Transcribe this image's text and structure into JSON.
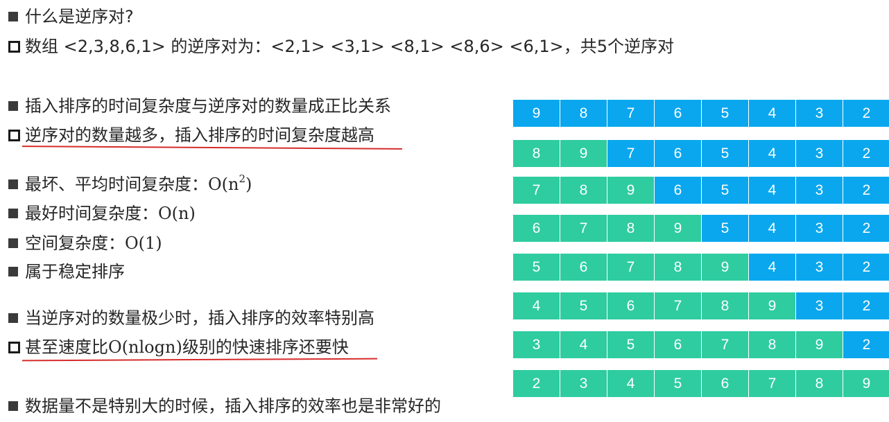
{
  "lines": [
    {
      "bullet": "filled",
      "text": "什么是逆序对?"
    },
    {
      "bullet": "hollow",
      "text": "数组 <2,3,8,6,1> 的逆序对为：<2,1> <3,1> <8,1> <8,6> <6,1>，共5个逆序对"
    },
    {
      "bullet": "filled",
      "text": "插入排序的时间复杂度与逆序对的数量成正比关系"
    },
    {
      "bullet": "hollow",
      "text": "逆序对的数量越多，插入排序的时间复杂度越高"
    },
    {
      "bullet": "filled",
      "prefix": "最坏、平均时间复杂度：",
      "math": "O(n",
      "sup": "2",
      "math_close": ")"
    },
    {
      "bullet": "filled",
      "prefix": "最好时间复杂度：",
      "math": "O(n)"
    },
    {
      "bullet": "filled",
      "prefix": "空间复杂度：",
      "math": "O(1)"
    },
    {
      "bullet": "filled",
      "text": "属于稳定排序"
    },
    {
      "bullet": "filled",
      "text": "当逆序对的数量极少时，插入排序的效率特别高"
    },
    {
      "bullet": "hollow",
      "prefix": "甚至速度比 ",
      "math": "O(nlogn)",
      "suffix": " 级别的快速排序还要快"
    },
    {
      "bullet": "filled",
      "text": "数据量不是特别大的时候，插入排序的效率也是非常好的"
    }
  ],
  "colors": {
    "unsorted": "#0aa7ee",
    "sorted": "#2fcca0",
    "underline": "#d62b2b"
  },
  "array_rows": [
    {
      "values": [
        9,
        8,
        7,
        6,
        5,
        4,
        3,
        2
      ],
      "sorted_count": 0
    },
    {
      "values": [
        8,
        9,
        7,
        6,
        5,
        4,
        3,
        2
      ],
      "sorted_count": 2
    },
    {
      "values": [
        7,
        8,
        9,
        6,
        5,
        4,
        3,
        2
      ],
      "sorted_count": 3
    },
    {
      "values": [
        6,
        7,
        8,
        9,
        5,
        4,
        3,
        2
      ],
      "sorted_count": 4
    },
    {
      "values": [
        5,
        6,
        7,
        8,
        9,
        4,
        3,
        2
      ],
      "sorted_count": 5
    },
    {
      "values": [
        4,
        5,
        6,
        7,
        8,
        9,
        3,
        2
      ],
      "sorted_count": 6
    },
    {
      "values": [
        3,
        4,
        5,
        6,
        7,
        8,
        9,
        2
      ],
      "sorted_count": 7
    },
    {
      "values": [
        2,
        3,
        4,
        5,
        6,
        7,
        8,
        9
      ],
      "sorted_count": 8
    }
  ]
}
